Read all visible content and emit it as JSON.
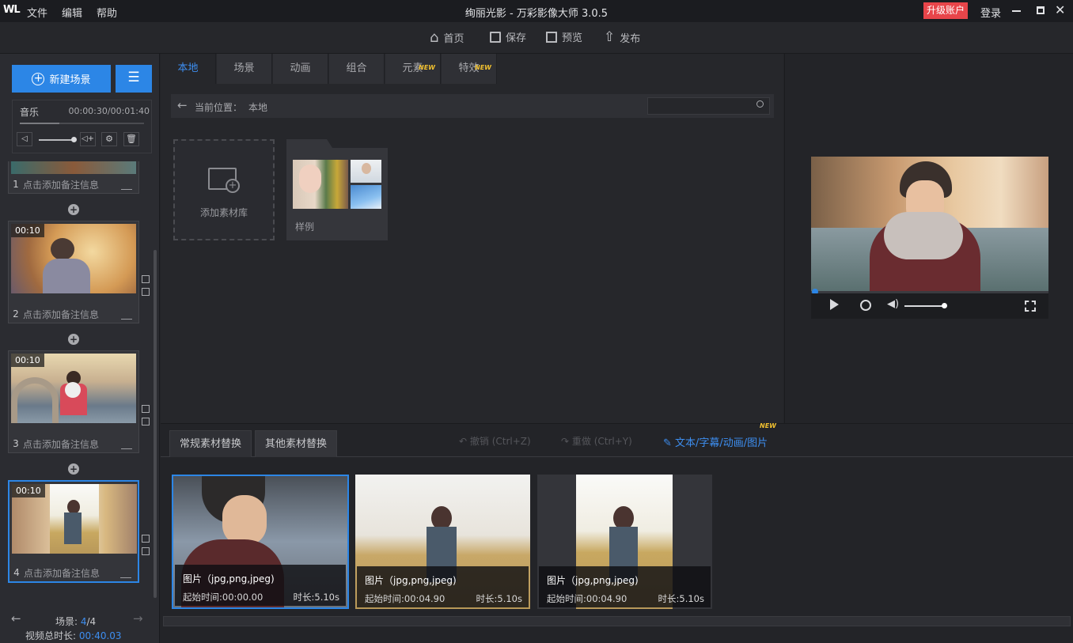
{
  "app": {
    "logo": "WL",
    "title": "绚丽光影 - 万彩影像大师 3.0.5",
    "upgrade": "升级账户",
    "login": "登录"
  },
  "menu": {
    "file": "文件",
    "edit": "编辑",
    "help": "帮助"
  },
  "toolbar": {
    "home": "首页",
    "save": "保存",
    "preview": "预览",
    "publish": "发布"
  },
  "left": {
    "new_scene": "新建场景",
    "music_label": "音乐",
    "music_time": "00:00:30/00:01:40",
    "scenes": [
      {
        "num": "1",
        "note": "点击添加备注信息",
        "dur": ""
      },
      {
        "num": "2",
        "note": "点击添加备注信息",
        "dur": "00:10"
      },
      {
        "num": "3",
        "note": "点击添加备注信息",
        "dur": "00:10"
      },
      {
        "num": "4",
        "note": "点击添加备注信息",
        "dur": "00:10"
      }
    ],
    "scene_label": "场景:",
    "scene_current": "4",
    "scene_total": "/4",
    "total_label": "视频总时长:",
    "total_value": "00:40.03"
  },
  "tabs": [
    {
      "label": "本地",
      "new": ""
    },
    {
      "label": "场景",
      "new": ""
    },
    {
      "label": "动画",
      "new": ""
    },
    {
      "label": "组合",
      "new": ""
    },
    {
      "label": "元素",
      "new": "NEW"
    },
    {
      "label": "特效",
      "new": "NEW"
    }
  ],
  "library": {
    "location_label": "当前位置：",
    "location_value": "本地",
    "search_placeholder": "",
    "add_label": "添加素材库",
    "sample_label": "样例"
  },
  "bottom": {
    "tab_regular": "常规素材替换",
    "tab_other": "其他素材替换",
    "undo": "撤销 (Ctrl+Z)",
    "redo": "重做 (Ctrl+Y)",
    "text_link": "文本/字幕/动画/图片",
    "text_link_new": "NEW",
    "items": [
      {
        "type": "图片（jpg,png,jpeg)",
        "start": "起始时间:00:00.00",
        "dur": "时长:5.10s"
      },
      {
        "type": "图片（jpg,png,jpeg)",
        "start": "起始时间:00:04.90",
        "dur": "时长:5.10s"
      },
      {
        "type": "图片（jpg,png,jpeg)",
        "start": "起始时间:00:04.90",
        "dur": "时长:5.10s"
      }
    ]
  },
  "colors": {
    "accent": "#3d8ef0",
    "upgrade_bg": "#e8454a",
    "panel": "#2b2c31"
  }
}
